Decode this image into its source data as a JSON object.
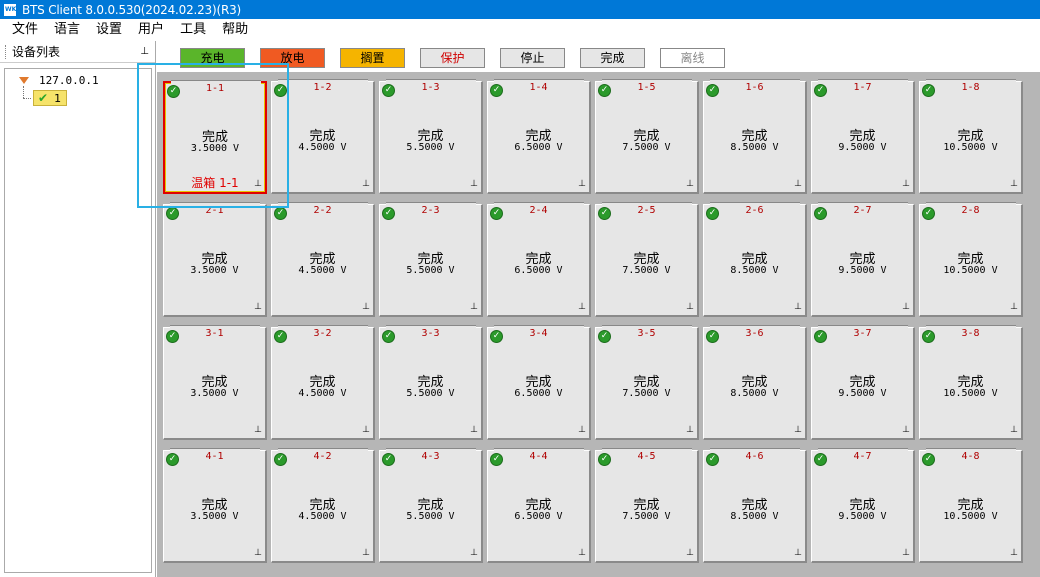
{
  "window": {
    "title": "BTS Client 8.0.0.530(2024.02.23)(R3)",
    "icon_label": "WK"
  },
  "menu": [
    "文件",
    "语言",
    "设置",
    "用户",
    "工具",
    "帮助"
  ],
  "sidebar": {
    "title": "设备列表",
    "pin_glyph": "⊥",
    "tree": {
      "root_label": "127.0.0.1",
      "child_label": "1"
    }
  },
  "legend": [
    {
      "label": "充电",
      "bg": "#5ab52a",
      "color": "#000000"
    },
    {
      "label": "放电",
      "bg": "#f05a22",
      "color": "#000000"
    },
    {
      "label": "搁置",
      "bg": "#f5b400",
      "color": "#000000"
    },
    {
      "label": "保护",
      "bg": "#e6e6e6",
      "color": "#d00000"
    },
    {
      "label": "停止",
      "bg": "#e6e6e6",
      "color": "#000000"
    },
    {
      "label": "完成",
      "bg": "#e6e6e6",
      "color": "#000000"
    },
    {
      "label": "离线",
      "bg": "#ffffff",
      "color": "#888888"
    }
  ],
  "channels": {
    "rows": [
      [
        {
          "id": "1-1",
          "status": "完成",
          "voltage": "3.5000 V",
          "chamber": "温箱 1-1"
        },
        {
          "id": "1-2",
          "status": "完成",
          "voltage": "4.5000 V"
        },
        {
          "id": "1-3",
          "status": "完成",
          "voltage": "5.5000 V"
        },
        {
          "id": "1-4",
          "status": "完成",
          "voltage": "6.5000 V"
        },
        {
          "id": "1-5",
          "status": "完成",
          "voltage": "7.5000 V"
        },
        {
          "id": "1-6",
          "status": "完成",
          "voltage": "8.5000 V"
        },
        {
          "id": "1-7",
          "status": "完成",
          "voltage": "9.5000 V"
        },
        {
          "id": "1-8",
          "status": "完成",
          "voltage": "10.5000 V"
        }
      ],
      [
        {
          "id": "2-1",
          "status": "完成",
          "voltage": "3.5000 V"
        },
        {
          "id": "2-2",
          "status": "完成",
          "voltage": "4.5000 V"
        },
        {
          "id": "2-3",
          "status": "完成",
          "voltage": "5.5000 V"
        },
        {
          "id": "2-4",
          "status": "完成",
          "voltage": "6.5000 V"
        },
        {
          "id": "2-5",
          "status": "完成",
          "voltage": "7.5000 V"
        },
        {
          "id": "2-6",
          "status": "完成",
          "voltage": "8.5000 V"
        },
        {
          "id": "2-7",
          "status": "完成",
          "voltage": "9.5000 V"
        },
        {
          "id": "2-8",
          "status": "完成",
          "voltage": "10.5000 V"
        }
      ],
      [
        {
          "id": "3-1",
          "status": "完成",
          "voltage": "3.5000 V"
        },
        {
          "id": "3-2",
          "status": "完成",
          "voltage": "4.5000 V"
        },
        {
          "id": "3-3",
          "status": "完成",
          "voltage": "5.5000 V"
        },
        {
          "id": "3-4",
          "status": "完成",
          "voltage": "6.5000 V"
        },
        {
          "id": "3-5",
          "status": "完成",
          "voltage": "7.5000 V"
        },
        {
          "id": "3-6",
          "status": "完成",
          "voltage": "8.5000 V"
        },
        {
          "id": "3-7",
          "status": "完成",
          "voltage": "9.5000 V"
        },
        {
          "id": "3-8",
          "status": "完成",
          "voltage": "10.5000 V"
        }
      ],
      [
        {
          "id": "4-1",
          "status": "完成",
          "voltage": "3.5000 V"
        },
        {
          "id": "4-2",
          "status": "完成",
          "voltage": "4.5000 V"
        },
        {
          "id": "4-3",
          "status": "完成",
          "voltage": "5.5000 V"
        },
        {
          "id": "4-4",
          "status": "完成",
          "voltage": "6.5000 V"
        },
        {
          "id": "4-5",
          "status": "完成",
          "voltage": "7.5000 V"
        },
        {
          "id": "4-6",
          "status": "完成",
          "voltage": "8.5000 V"
        },
        {
          "id": "4-7",
          "status": "完成",
          "voltage": "9.5000 V"
        },
        {
          "id": "4-8",
          "status": "完成",
          "voltage": "10.5000 V"
        }
      ]
    ]
  }
}
